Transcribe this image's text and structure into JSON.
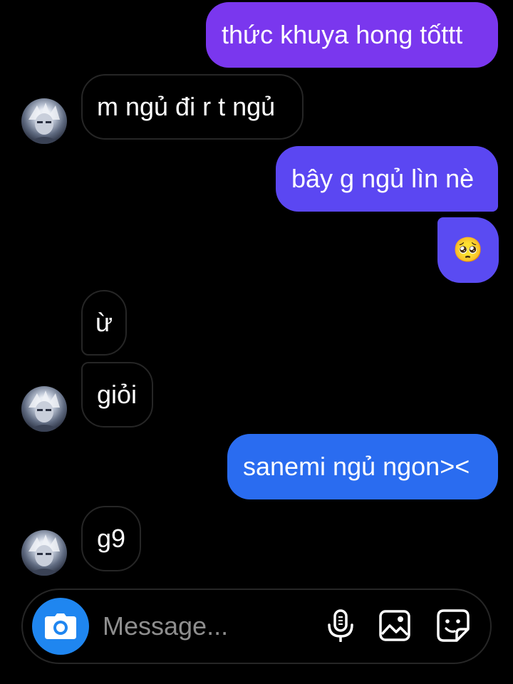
{
  "conversation": {
    "messages": [
      {
        "sender": "me",
        "text": "thức khuya hong tốttt"
      },
      {
        "sender": "them",
        "text": "m ngủ đi r t ngủ"
      },
      {
        "sender": "me",
        "text": "bây g ngủ lìn nè"
      },
      {
        "sender": "me",
        "text": "🥺"
      },
      {
        "sender": "them",
        "text": "ừ"
      },
      {
        "sender": "them",
        "text": "giỏi"
      },
      {
        "sender": "me",
        "text": "sanemi ngủ ngon><"
      },
      {
        "sender": "them",
        "text": "g9"
      }
    ],
    "colors": {
      "background": "#000000",
      "sent_gradient_top": "#7c3aed",
      "sent_gradient_bottom": "#2a6cf0",
      "received_border": "#262626",
      "text": "#ffffff"
    }
  },
  "composer": {
    "placeholder": "Message...",
    "value": "",
    "icons": [
      "camera-icon",
      "microphone-icon",
      "gallery-icon",
      "sticker-icon"
    ],
    "camera_button_color": "#1f86f0",
    "placeholder_color": "#8e8e8e"
  }
}
